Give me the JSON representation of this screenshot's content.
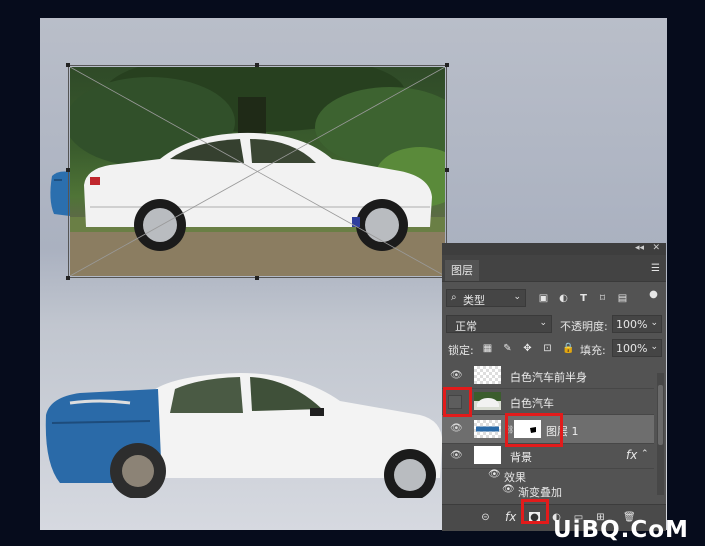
{
  "layers_panel": {
    "collapse_icon": "collapse-icon",
    "close_icon": "close-icon",
    "tab_label": "图层",
    "filter_label": "类型",
    "blend_mode": "正常",
    "opacity_label": "不透明度:",
    "opacity_value": "100%",
    "lock_label": "锁定:",
    "fill_label": "填充:",
    "fill_value": "100%",
    "layers": [
      {
        "name": "白色汽车前半身"
      },
      {
        "name": "白色汽车"
      },
      {
        "name": "图层 1"
      },
      {
        "name": "背景",
        "fx": "fx"
      }
    ],
    "effects_label": "效果",
    "effect_item": "渐变叠加",
    "footer_fx": "fx"
  },
  "watermark": "UiBQ.CoM",
  "colors": {
    "panel_bg": "#535353",
    "highlight_red": "#e21b1b",
    "canvas_bg": "#b3b8c4",
    "car_blue": "#2a6aa8"
  }
}
